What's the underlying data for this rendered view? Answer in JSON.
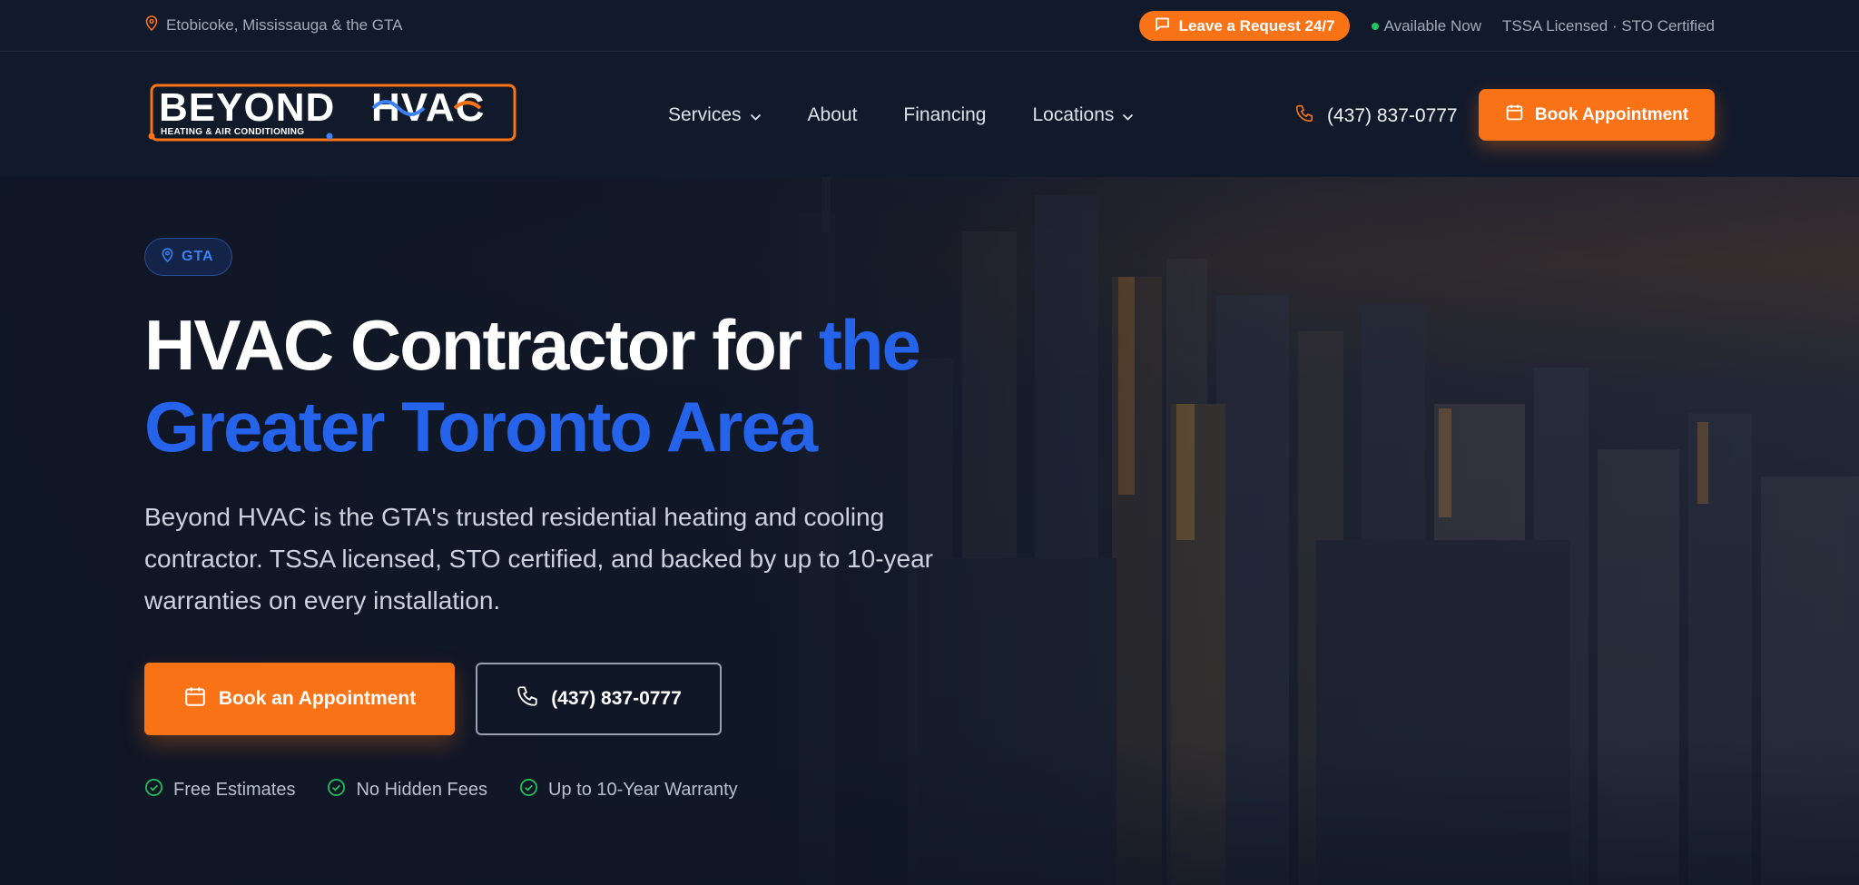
{
  "topbar": {
    "location": "Etobicoke, Mississauga & the GTA",
    "request_label": "Leave a Request 24/7",
    "availability": "Available Now",
    "license": "TSSA Licensed · STO Certified"
  },
  "nav": {
    "logo_text": "BEYOND HVAC",
    "logo_tagline": "HEATING & AIR CONDITIONING",
    "menu": [
      {
        "label": "Services",
        "dropdown": true
      },
      {
        "label": "About",
        "dropdown": false
      },
      {
        "label": "Financing",
        "dropdown": false
      },
      {
        "label": "Locations",
        "dropdown": true
      }
    ],
    "phone": "(437) 837-0777",
    "book_label": "Book Appointment"
  },
  "hero": {
    "badge": "GTA",
    "headline_plain": "HVAC Contractor for ",
    "headline_accent_1": "the",
    "headline_accent_2": "Greater Toronto Area",
    "lead": "Beyond HVAC is the GTA's trusted residential heating and cooling contractor. TSSA licensed, STO certified, and backed by up to 10-year warranties on every installation.",
    "cta_primary": "Book an Appointment",
    "cta_secondary": "(437) 837-0777",
    "perks": [
      "Free Estimates",
      "No Hidden Fees",
      "Up to 10-Year Warranty"
    ]
  },
  "colors": {
    "accent_orange": "#f97316",
    "accent_blue": "#2563eb",
    "status_green": "#22c55e",
    "background": "#111a2b"
  }
}
